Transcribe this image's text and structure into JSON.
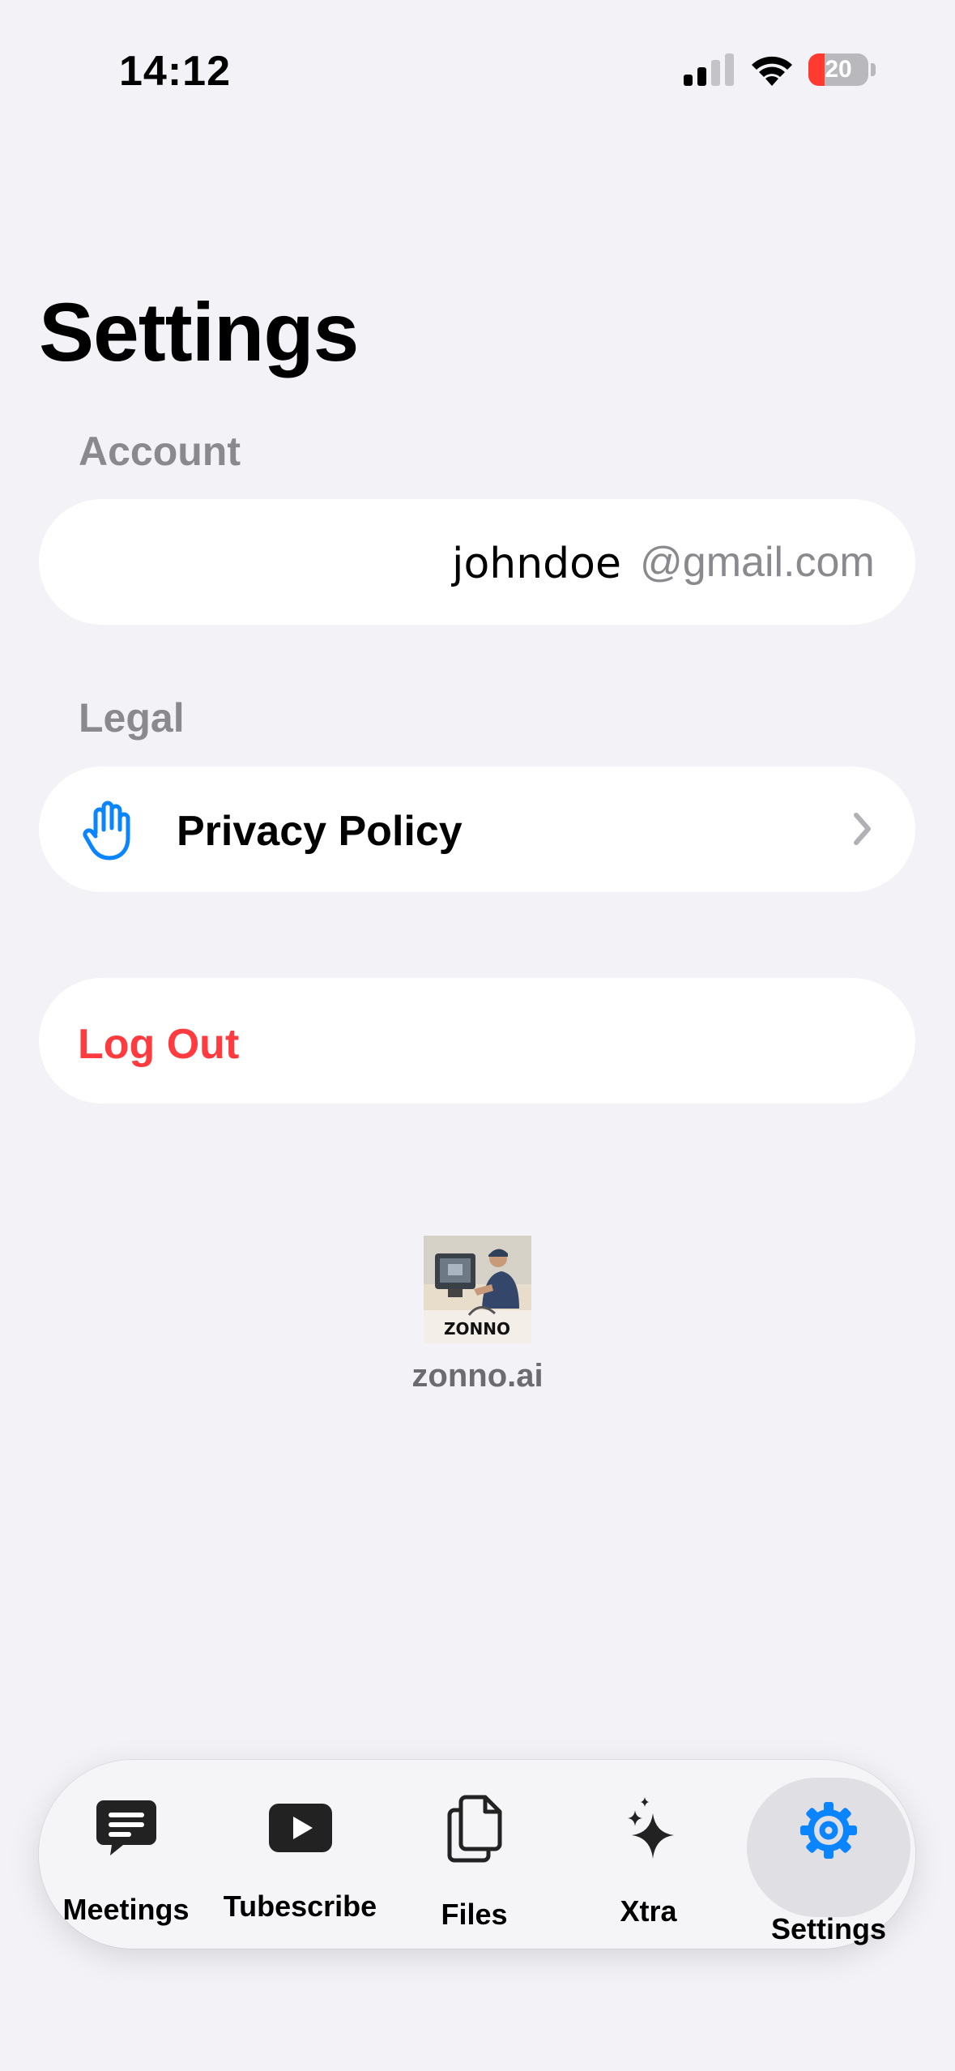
{
  "status_bar": {
    "time": "14:12",
    "battery": "20"
  },
  "header": {
    "title": "Settings"
  },
  "account": {
    "section_label": "Account",
    "username": "johndoe",
    "domain": "@gmail.com"
  },
  "legal": {
    "section_label": "Legal",
    "privacy_label": "Privacy Policy"
  },
  "logout": {
    "label": "Log Out"
  },
  "branding": {
    "logo_text": "ZONNO",
    "caption": "zonno.ai"
  },
  "tabs": [
    {
      "label": "Meetings",
      "icon": "message-icon"
    },
    {
      "label": "Tubescribe",
      "icon": "play-icon"
    },
    {
      "label": "Files",
      "icon": "files-icon"
    },
    {
      "label": "Xtra",
      "icon": "sparkles-icon"
    },
    {
      "label": "Settings",
      "icon": "gear-icon",
      "selected": true
    }
  ],
  "colors": {
    "accent": "#0a84ff",
    "destructive": "#ff3b3f",
    "background": "#f2f2f7",
    "battery_low": "#ff3b30"
  }
}
